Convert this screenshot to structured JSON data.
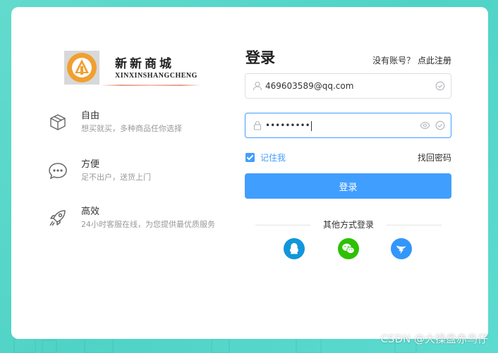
{
  "brand": {
    "name_cn": "新新商城",
    "name_en": "XINXINSHANGCHENG"
  },
  "features": [
    {
      "title": "自由",
      "desc": "想买就买，多种商品任你选择",
      "icon": "box-icon"
    },
    {
      "title": "方便",
      "desc": "足不出户，送货上门",
      "icon": "chat-bubble-icon"
    },
    {
      "title": "高效",
      "desc": "24小时客服在线，为您提供最优质服务",
      "icon": "rocket-icon"
    }
  ],
  "form": {
    "title": "登录",
    "no_account": "没有账号？",
    "register_link": "点此注册",
    "username_value": "469603589@qq.com",
    "password_mask": "•••••••••",
    "remember_label": "记住我",
    "remember_checked": true,
    "forgot_link": "找回密码",
    "submit_label": "登录",
    "other_methods": "其他方式登录"
  },
  "social": [
    {
      "name": "qq-icon",
      "color": "#1296db"
    },
    {
      "name": "wechat-icon",
      "color": "#2dc100"
    },
    {
      "name": "dingtalk-icon",
      "color": "#3296fa"
    }
  ],
  "colors": {
    "accent": "#409eff",
    "background": "#55d6c9"
  },
  "watermark": "CSDN @大操盘赤鸟仔"
}
